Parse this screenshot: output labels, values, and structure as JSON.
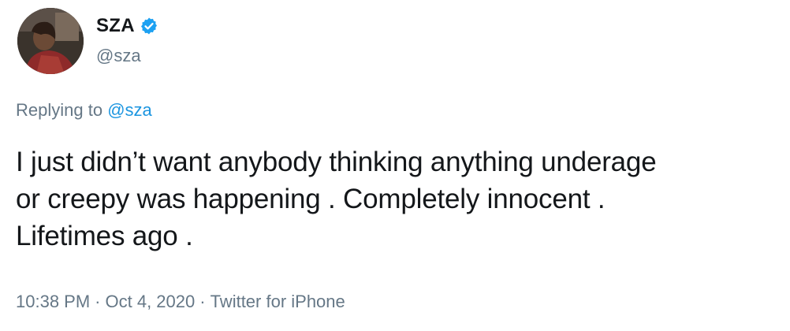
{
  "author": {
    "display_name": "SZA",
    "handle": "@sza",
    "verified": true,
    "avatar_icon": "profile-photo"
  },
  "reply": {
    "prefix": "Replying to",
    "mention": "@sza"
  },
  "tweet": {
    "lines": [
      "I just didn’t want anybody thinking anything underage",
      "or creepy was happening . Completely innocent .",
      "Lifetimes ago ."
    ]
  },
  "meta": {
    "time": "10:38 PM",
    "separator": "·",
    "date": "Oct 4, 2020",
    "source": "Twitter for iPhone"
  },
  "colors": {
    "text": "#14171a",
    "secondary": "#657786",
    "link": "#1b95e0",
    "verified_badge": "#1da1f2"
  }
}
